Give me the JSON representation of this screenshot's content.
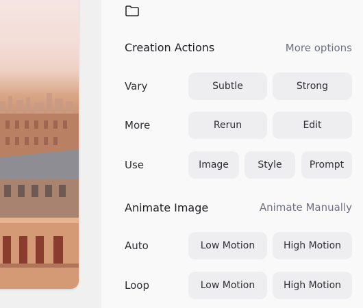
{
  "panel": {
    "icons": {
      "folder": "folder-icon"
    },
    "creation_actions": {
      "title": "Creation Actions",
      "more_options": "More options",
      "rows": [
        {
          "label": "Vary",
          "buttons": [
            "Subtle",
            "Strong"
          ]
        },
        {
          "label": "More",
          "buttons": [
            "Rerun",
            "Edit"
          ]
        },
        {
          "label": "Use",
          "buttons": [
            "Image",
            "Style",
            "Prompt"
          ]
        }
      ]
    },
    "animate_image": {
      "title": "Animate Image",
      "manual": "Animate Manually",
      "rows": [
        {
          "label": "Auto",
          "buttons": [
            "Low Motion",
            "High Motion"
          ]
        },
        {
          "label": "Loop",
          "buttons": [
            "Low Motion",
            "High Motion"
          ]
        }
      ]
    }
  }
}
